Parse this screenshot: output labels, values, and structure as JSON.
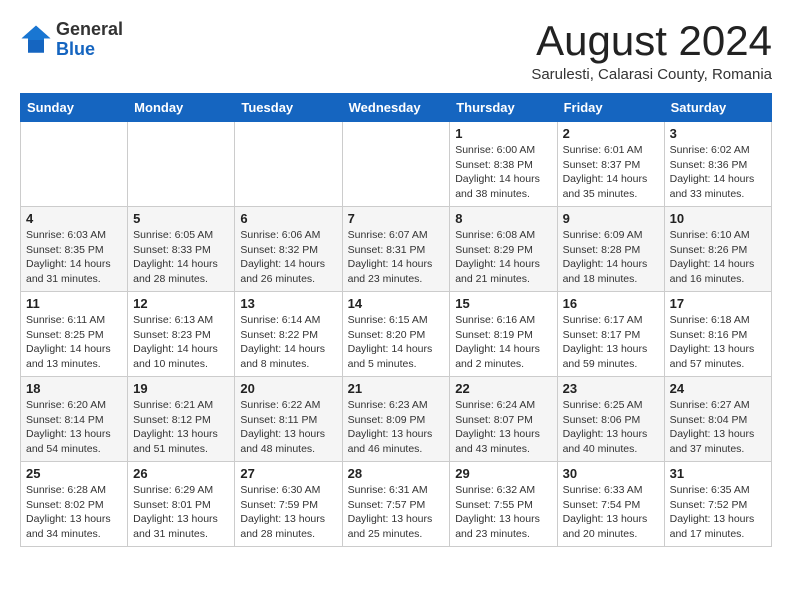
{
  "header": {
    "logo_general": "General",
    "logo_blue": "Blue",
    "month_title": "August 2024",
    "subtitle": "Sarulesti, Calarasi County, Romania"
  },
  "weekdays": [
    "Sunday",
    "Monday",
    "Tuesday",
    "Wednesday",
    "Thursday",
    "Friday",
    "Saturday"
  ],
  "weeks": [
    [
      {
        "day": "",
        "info": ""
      },
      {
        "day": "",
        "info": ""
      },
      {
        "day": "",
        "info": ""
      },
      {
        "day": "",
        "info": ""
      },
      {
        "day": "1",
        "info": "Sunrise: 6:00 AM\nSunset: 8:38 PM\nDaylight: 14 hours\nand 38 minutes."
      },
      {
        "day": "2",
        "info": "Sunrise: 6:01 AM\nSunset: 8:37 PM\nDaylight: 14 hours\nand 35 minutes."
      },
      {
        "day": "3",
        "info": "Sunrise: 6:02 AM\nSunset: 8:36 PM\nDaylight: 14 hours\nand 33 minutes."
      }
    ],
    [
      {
        "day": "4",
        "info": "Sunrise: 6:03 AM\nSunset: 8:35 PM\nDaylight: 14 hours\nand 31 minutes."
      },
      {
        "day": "5",
        "info": "Sunrise: 6:05 AM\nSunset: 8:33 PM\nDaylight: 14 hours\nand 28 minutes."
      },
      {
        "day": "6",
        "info": "Sunrise: 6:06 AM\nSunset: 8:32 PM\nDaylight: 14 hours\nand 26 minutes."
      },
      {
        "day": "7",
        "info": "Sunrise: 6:07 AM\nSunset: 8:31 PM\nDaylight: 14 hours\nand 23 minutes."
      },
      {
        "day": "8",
        "info": "Sunrise: 6:08 AM\nSunset: 8:29 PM\nDaylight: 14 hours\nand 21 minutes."
      },
      {
        "day": "9",
        "info": "Sunrise: 6:09 AM\nSunset: 8:28 PM\nDaylight: 14 hours\nand 18 minutes."
      },
      {
        "day": "10",
        "info": "Sunrise: 6:10 AM\nSunset: 8:26 PM\nDaylight: 14 hours\nand 16 minutes."
      }
    ],
    [
      {
        "day": "11",
        "info": "Sunrise: 6:11 AM\nSunset: 8:25 PM\nDaylight: 14 hours\nand 13 minutes."
      },
      {
        "day": "12",
        "info": "Sunrise: 6:13 AM\nSunset: 8:23 PM\nDaylight: 14 hours\nand 10 minutes."
      },
      {
        "day": "13",
        "info": "Sunrise: 6:14 AM\nSunset: 8:22 PM\nDaylight: 14 hours\nand 8 minutes."
      },
      {
        "day": "14",
        "info": "Sunrise: 6:15 AM\nSunset: 8:20 PM\nDaylight: 14 hours\nand 5 minutes."
      },
      {
        "day": "15",
        "info": "Sunrise: 6:16 AM\nSunset: 8:19 PM\nDaylight: 14 hours\nand 2 minutes."
      },
      {
        "day": "16",
        "info": "Sunrise: 6:17 AM\nSunset: 8:17 PM\nDaylight: 13 hours\nand 59 minutes."
      },
      {
        "day": "17",
        "info": "Sunrise: 6:18 AM\nSunset: 8:16 PM\nDaylight: 13 hours\nand 57 minutes."
      }
    ],
    [
      {
        "day": "18",
        "info": "Sunrise: 6:20 AM\nSunset: 8:14 PM\nDaylight: 13 hours\nand 54 minutes."
      },
      {
        "day": "19",
        "info": "Sunrise: 6:21 AM\nSunset: 8:12 PM\nDaylight: 13 hours\nand 51 minutes."
      },
      {
        "day": "20",
        "info": "Sunrise: 6:22 AM\nSunset: 8:11 PM\nDaylight: 13 hours\nand 48 minutes."
      },
      {
        "day": "21",
        "info": "Sunrise: 6:23 AM\nSunset: 8:09 PM\nDaylight: 13 hours\nand 46 minutes."
      },
      {
        "day": "22",
        "info": "Sunrise: 6:24 AM\nSunset: 8:07 PM\nDaylight: 13 hours\nand 43 minutes."
      },
      {
        "day": "23",
        "info": "Sunrise: 6:25 AM\nSunset: 8:06 PM\nDaylight: 13 hours\nand 40 minutes."
      },
      {
        "day": "24",
        "info": "Sunrise: 6:27 AM\nSunset: 8:04 PM\nDaylight: 13 hours\nand 37 minutes."
      }
    ],
    [
      {
        "day": "25",
        "info": "Sunrise: 6:28 AM\nSunset: 8:02 PM\nDaylight: 13 hours\nand 34 minutes."
      },
      {
        "day": "26",
        "info": "Sunrise: 6:29 AM\nSunset: 8:01 PM\nDaylight: 13 hours\nand 31 minutes."
      },
      {
        "day": "27",
        "info": "Sunrise: 6:30 AM\nSunset: 7:59 PM\nDaylight: 13 hours\nand 28 minutes."
      },
      {
        "day": "28",
        "info": "Sunrise: 6:31 AM\nSunset: 7:57 PM\nDaylight: 13 hours\nand 25 minutes."
      },
      {
        "day": "29",
        "info": "Sunrise: 6:32 AM\nSunset: 7:55 PM\nDaylight: 13 hours\nand 23 minutes."
      },
      {
        "day": "30",
        "info": "Sunrise: 6:33 AM\nSunset: 7:54 PM\nDaylight: 13 hours\nand 20 minutes."
      },
      {
        "day": "31",
        "info": "Sunrise: 6:35 AM\nSunset: 7:52 PM\nDaylight: 13 hours\nand 17 minutes."
      }
    ]
  ]
}
